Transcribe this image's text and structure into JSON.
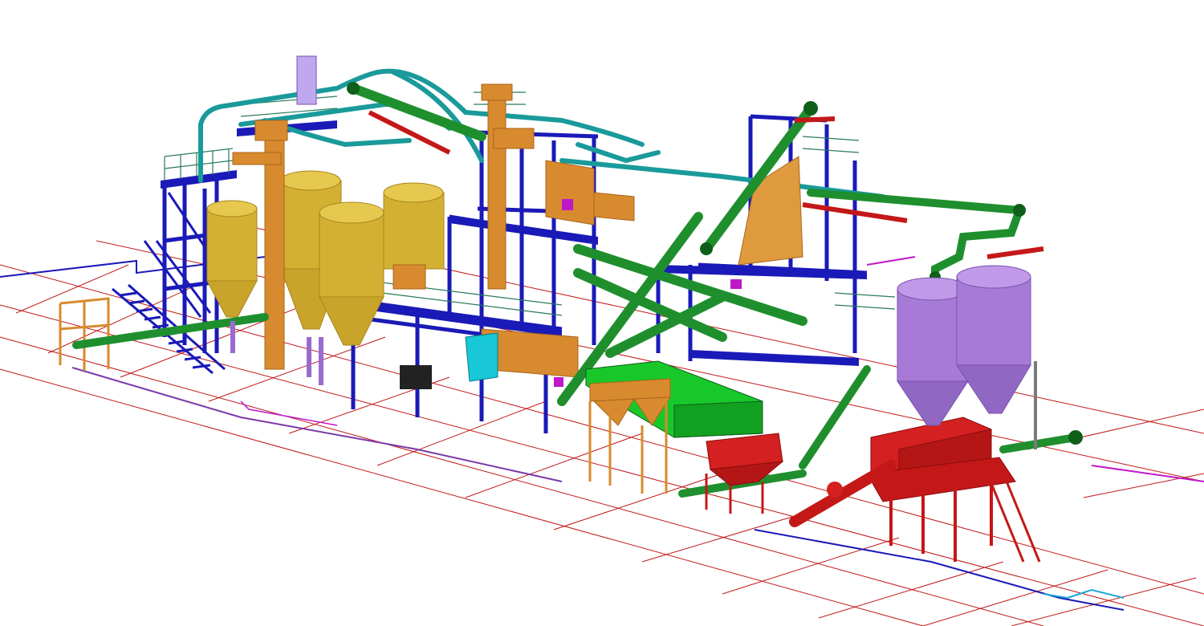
{
  "palette": {
    "background": "#ffffff",
    "steel_blue": "#1a1ab8",
    "steel_dark": "#0c0c7a",
    "conveyor_green": "#1f8f2e",
    "conveyor_dark": "#0f5e1a",
    "pipe_teal": "#1a9a9a",
    "silo_gold": "#d4b032",
    "silo_gold_dark": "#a8861c",
    "elevator_orange": "#d88a2e",
    "silo_purple": "#a87ad8",
    "silo_purple_dark": "#7a52ac",
    "hopper_red": "#c41818",
    "grid_red": "#c01818",
    "railing_green": "#2a7a5a",
    "cyan_accent": "#18c8d8",
    "magenta_accent": "#c018c8"
  },
  "components": [
    {
      "id": "gold-silo-1",
      "kind": "silo",
      "color": "silo_gold"
    },
    {
      "id": "gold-silo-2",
      "kind": "silo",
      "color": "silo_gold"
    },
    {
      "id": "gold-silo-3",
      "kind": "silo",
      "color": "silo_gold"
    },
    {
      "id": "gold-silo-4",
      "kind": "silo",
      "color": "silo_gold"
    },
    {
      "id": "purple-silo-1",
      "kind": "silo",
      "color": "silo_purple"
    },
    {
      "id": "purple-silo-2",
      "kind": "silo",
      "color": "silo_purple"
    },
    {
      "id": "bucket-elevator-1",
      "kind": "elevator",
      "color": "elevator_orange"
    },
    {
      "id": "bucket-elevator-2",
      "kind": "elevator",
      "color": "elevator_orange"
    },
    {
      "id": "red-hopper-platform",
      "kind": "hopper",
      "color": "hopper_red"
    },
    {
      "id": "red-hopper-small",
      "kind": "hopper",
      "color": "hopper_red"
    },
    {
      "id": "orange-twin-hoppers",
      "kind": "hopper",
      "color": "elevator_orange"
    },
    {
      "id": "green-conveyor-main",
      "kind": "conveyor",
      "color": "conveyor_green"
    },
    {
      "id": "green-conveyor-right",
      "kind": "conveyor",
      "color": "conveyor_green"
    },
    {
      "id": "green-box-mixer",
      "kind": "equipment",
      "color": "conveyor_green"
    },
    {
      "id": "blue-steel-structure",
      "kind": "structure",
      "color": "steel_blue"
    },
    {
      "id": "teal-pneumatic-pipes",
      "kind": "pipe",
      "color": "pipe_teal"
    },
    {
      "id": "floor-grid",
      "kind": "grid",
      "color": "grid_red"
    }
  ]
}
